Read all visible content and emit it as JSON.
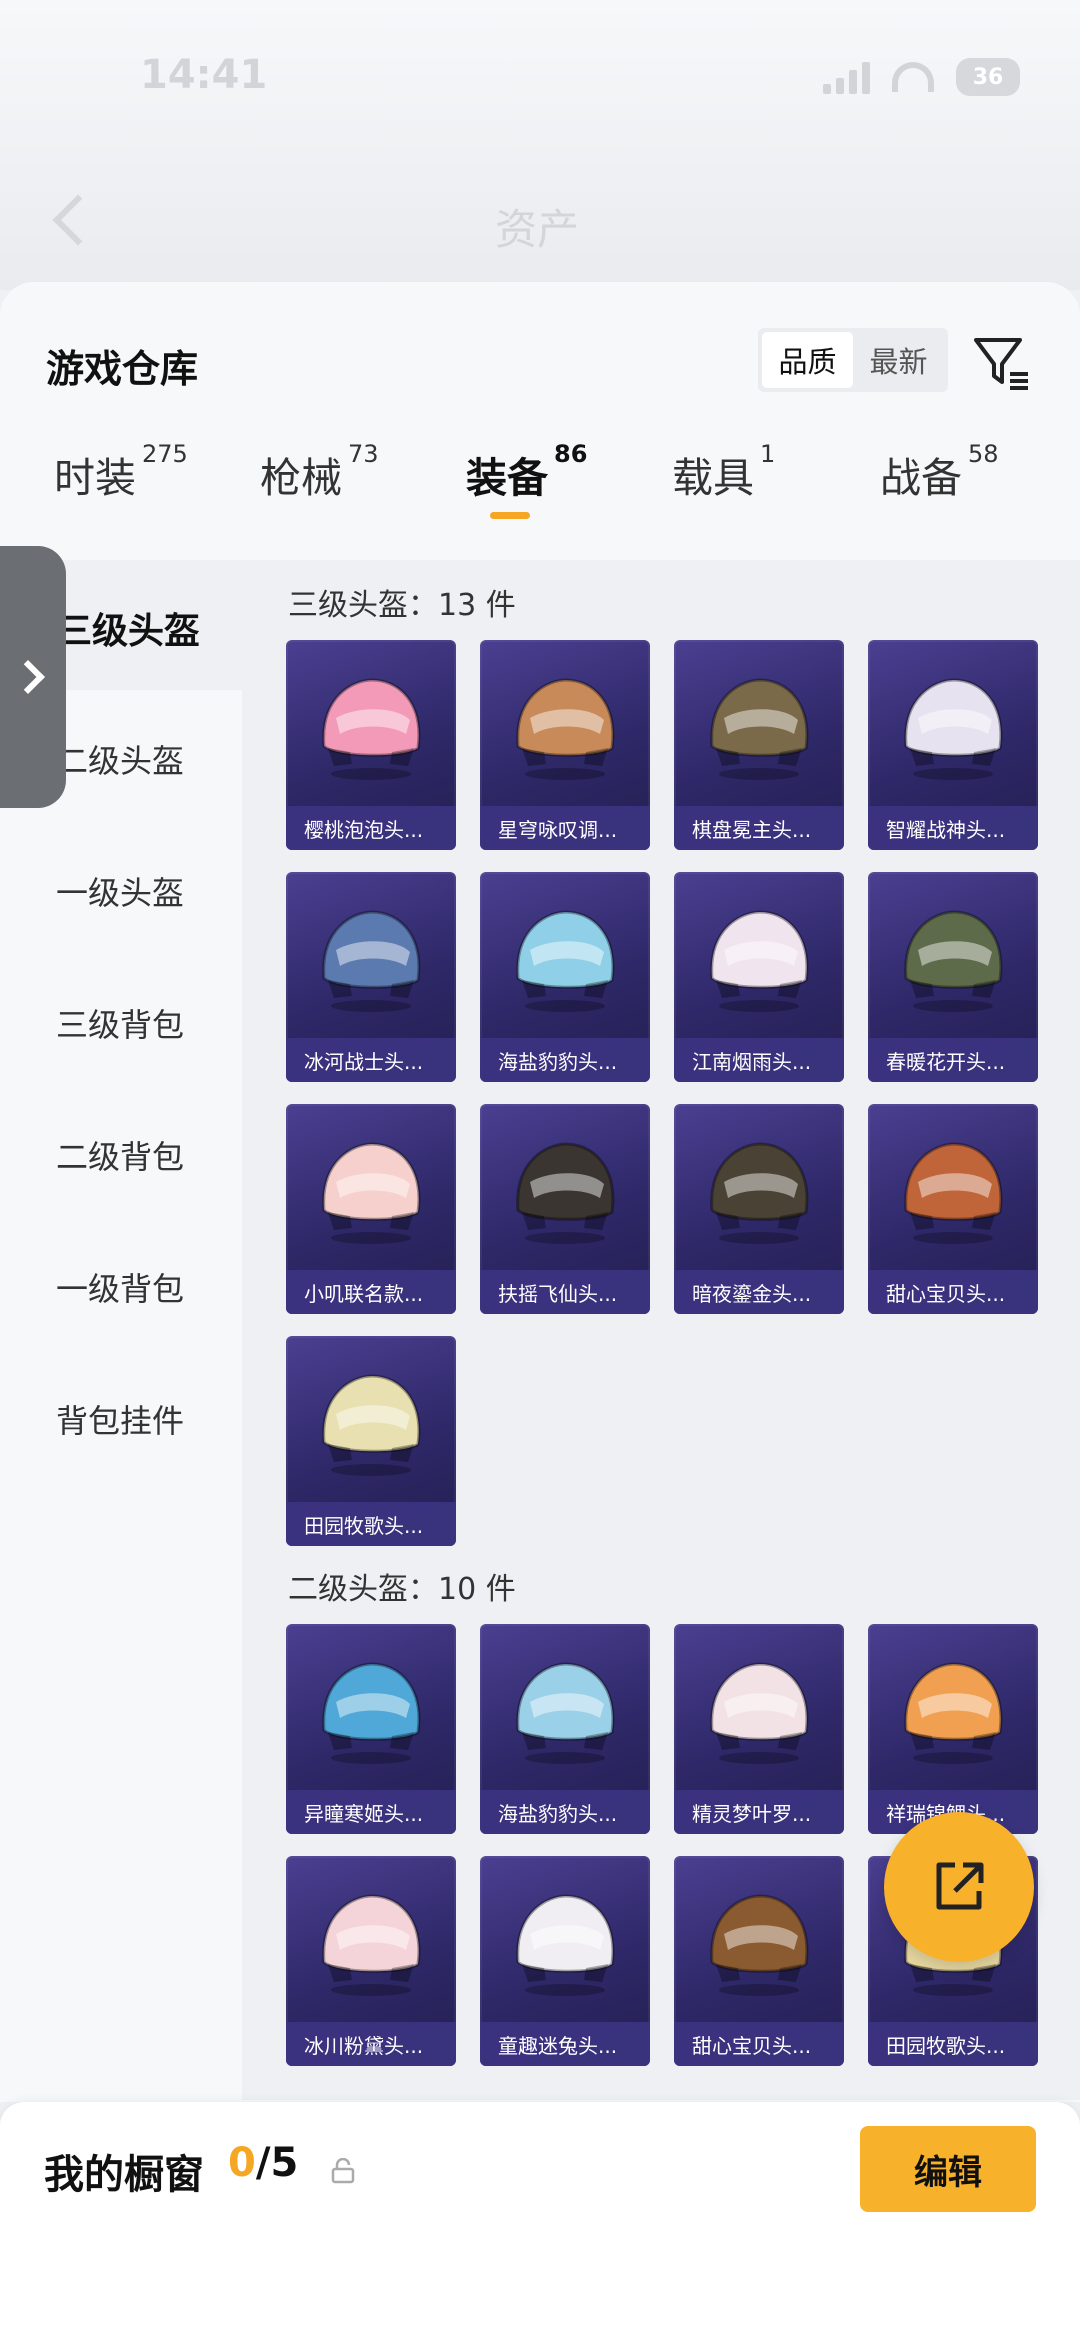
{
  "status": {
    "time": "14:41",
    "battery": "36"
  },
  "header": {
    "title": "资产"
  },
  "panel": {
    "title": "游戏仓库",
    "sort_options": [
      "品质",
      "最新"
    ],
    "active_sort": "品质"
  },
  "categories": [
    {
      "label": "时装",
      "count": "275"
    },
    {
      "label": "枪械",
      "count": "73"
    },
    {
      "label": "装备",
      "count": "86"
    },
    {
      "label": "载具",
      "count": "1"
    },
    {
      "label": "战备",
      "count": "58"
    }
  ],
  "active_category": "装备",
  "sidebar": {
    "items": [
      "三级头盔",
      "二级头盔",
      "一级头盔",
      "三级背包",
      "二级背包",
      "一级背包",
      "背包挂件"
    ]
  },
  "sections": [
    {
      "title": "三级头盔：13 件",
      "items": [
        "樱桃泡泡头...",
        "星穹咏叹调...",
        "棋盘冕主头...",
        "智耀战神头...",
        "冰河战士头...",
        "海盐豹豹头...",
        "江南烟雨头...",
        "春暖花开头...",
        "小叽联名款...",
        "扶摇飞仙头...",
        "暗夜鎏金头...",
        "甜心宝贝头...",
        "田园牧歌头..."
      ]
    },
    {
      "title": "二级头盔：10 件",
      "items": [
        "异瞳寒姬头...",
        "海盐豹豹头...",
        "精灵梦叶罗...",
        "祥瑞锦鲤头...",
        "冰川粉黛头...",
        "童趣迷兔头...",
        "甜心宝贝头...",
        "田园牧歌头..."
      ]
    }
  ],
  "helmet_colors": [
    "#f29ab8",
    "#c98a5a",
    "#7a6a4a",
    "#e7e2ef",
    "#5a7ab0",
    "#8fd0e8",
    "#f0e4ee",
    "#5d6b4a",
    "#f6d0cc",
    "#3a3530",
    "#4a4234",
    "#c0643a",
    "#e8e0b0",
    "#4fa8d8",
    "#9ad0e8",
    "#f2e2e6",
    "#f0a050",
    "#f4d4d8",
    "#f0eef2",
    "#8a5a30",
    "#e8d8a0"
  ],
  "showcase": {
    "label": "我的橱窗",
    "current": "0",
    "total": "/5"
  },
  "edit_label": "编辑"
}
